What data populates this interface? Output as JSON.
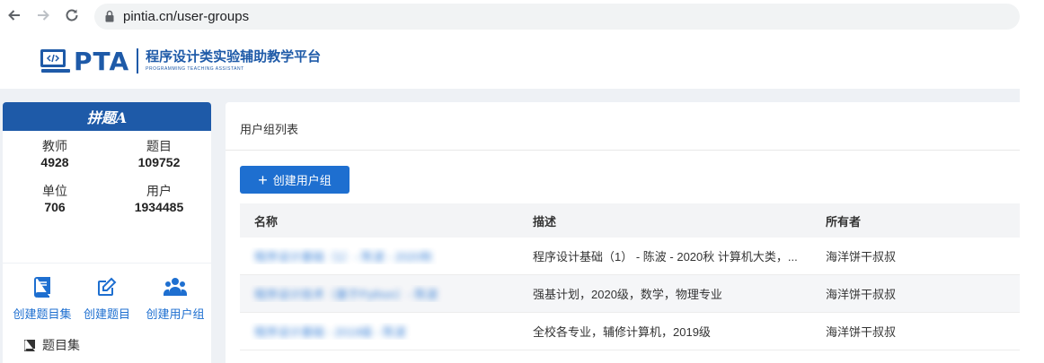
{
  "browser": {
    "url": "pintia.cn/user-groups"
  },
  "header": {
    "logo_main": "PTA",
    "logo_cn": "程序设计类实验辅助教学平台",
    "logo_en": "PROGRAMMING TEACHING ASSISTANT"
  },
  "sidebar": {
    "banner": "拼题A",
    "stats": [
      {
        "label": "教师",
        "value": "4928"
      },
      {
        "label": "题目",
        "value": "109752"
      },
      {
        "label": "单位",
        "value": "706"
      },
      {
        "label": "用户",
        "value": "1934485"
      }
    ],
    "actions": [
      {
        "label": "创建题目集",
        "icon": "book-icon"
      },
      {
        "label": "创建题目",
        "icon": "edit-icon"
      },
      {
        "label": "创建用户组",
        "icon": "users-icon"
      }
    ],
    "menu": [
      {
        "label": "题目集",
        "icon": "book-icon"
      }
    ]
  },
  "main": {
    "title": "用户组列表",
    "create_button": "创建用户组",
    "columns": [
      "名称",
      "描述",
      "所有者"
    ],
    "rows": [
      {
        "name": "程序设计基础（1）- 陈波 - 2020秋",
        "description": "程序设计基础（1） - 陈波 - 2020秋 计算机大类，...",
        "owner": "海洋饼干叔叔"
      },
      {
        "name": "程序设计技术（基于Python）- 陈波",
        "description": "强基计划，2020级，数学，物理专业",
        "owner": "海洋饼干叔叔"
      },
      {
        "name": "程序设计基础 - 2019级 - 陈波",
        "description": "全校各专业，辅修计算机，2019级",
        "owner": "海洋饼干叔叔"
      }
    ]
  },
  "colors": {
    "brand": "#1e5aa8",
    "accent": "#1e6fd0",
    "page_bg": "#eef1f5"
  }
}
